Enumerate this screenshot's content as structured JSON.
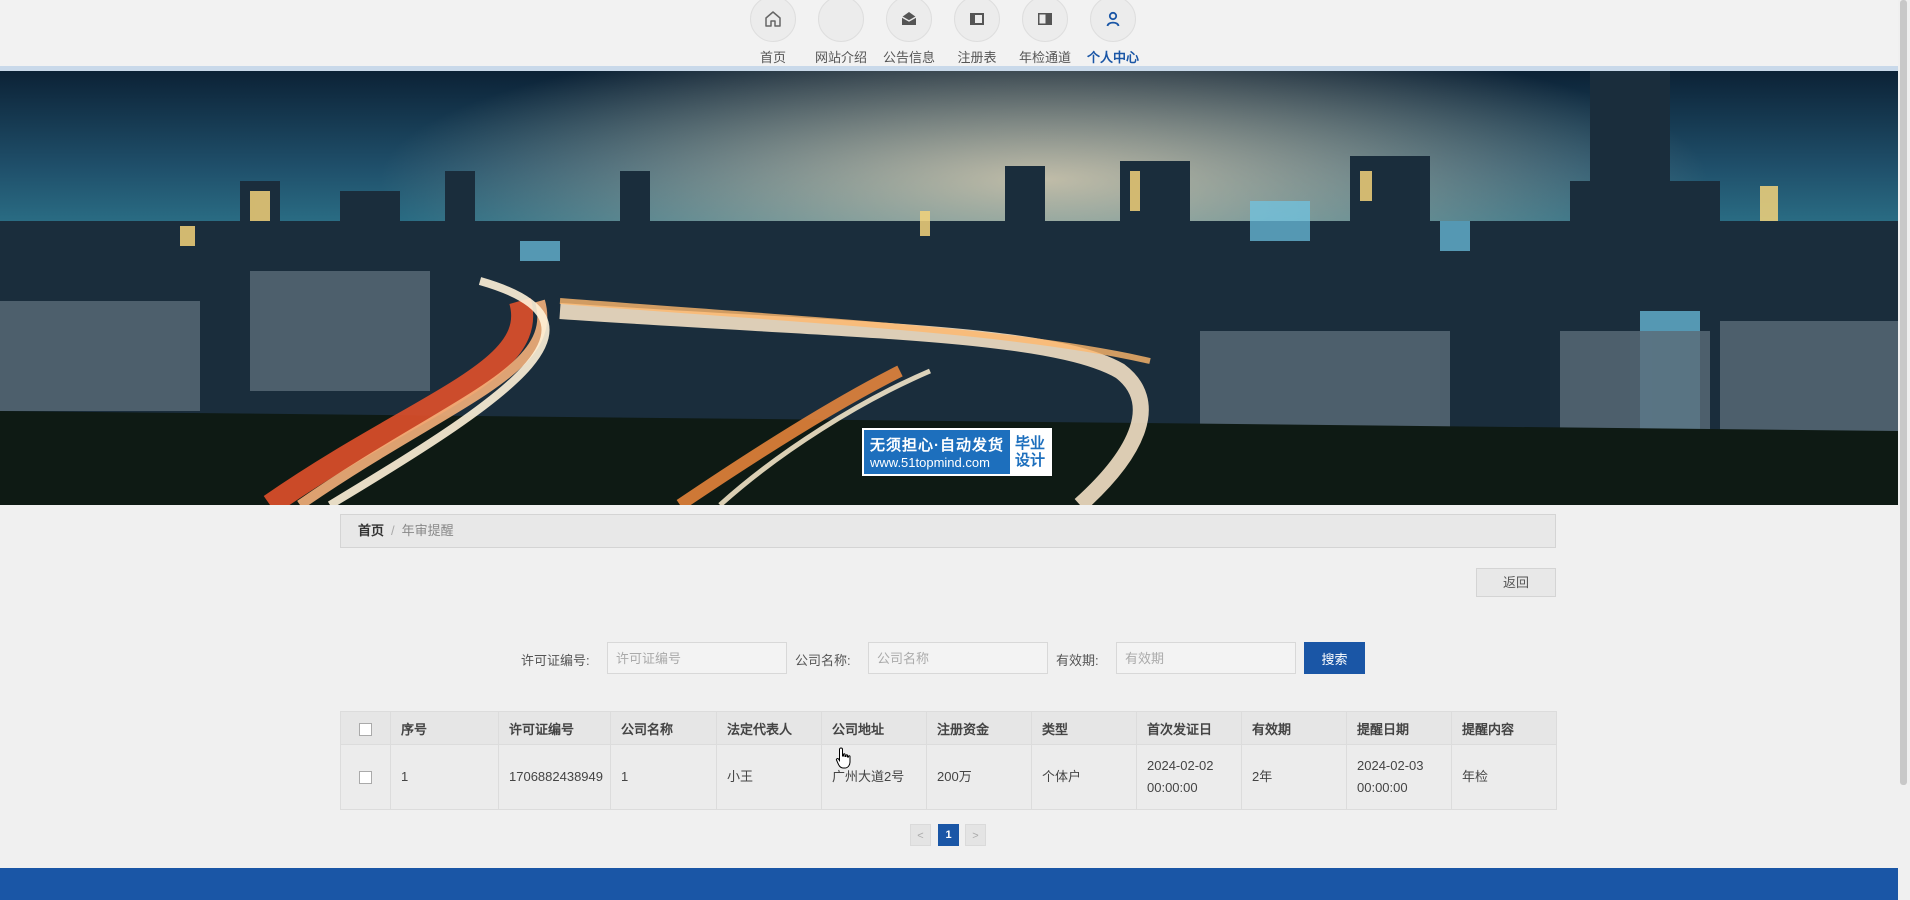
{
  "nav": {
    "items": [
      {
        "label": "首页",
        "icon": "home-icon"
      },
      {
        "label": "网站介绍",
        "icon": "blank-icon"
      },
      {
        "label": "公告信息",
        "icon": "envelope-icon"
      },
      {
        "label": "注册表",
        "icon": "sidebar-panel-icon"
      },
      {
        "label": "年检通道",
        "icon": "book-panel-icon"
      },
      {
        "label": "个人中心",
        "icon": "user-icon",
        "active": true
      }
    ]
  },
  "banner": {
    "watermark_main": "无须担心·自动发货",
    "watermark_url": "www.51topmind.com",
    "watermark_tag_line1": "毕业",
    "watermark_tag_line2": "设计"
  },
  "breadcrumb": {
    "home": "首页",
    "separator": "/",
    "current": "年审提醒"
  },
  "back_label": "返回",
  "search": {
    "license_label": "许可证编号:",
    "license_placeholder": "许可证编号",
    "company_label": "公司名称:",
    "company_placeholder": "公司名称",
    "validity_label": "有效期:",
    "validity_placeholder": "有效期",
    "button_label": "搜索"
  },
  "table": {
    "headers": [
      "序号",
      "许可证编号",
      "公司名称",
      "法定代表人",
      "公司地址",
      "注册资金",
      "类型",
      "首次发证日",
      "有效期",
      "提醒日期",
      "提醒内容"
    ],
    "rows": [
      [
        "1",
        "1706882438949",
        "1",
        "小王",
        "广州大道2号",
        "200万",
        "个体户",
        "2024-02-02 00:00:00",
        "2年",
        "2024-02-03 00:00:00",
        "年检"
      ]
    ]
  },
  "pagination": {
    "prev": "<",
    "current": "1",
    "next": ">"
  },
  "colors": {
    "primary": "#1a56a6",
    "footer": "#1a56a6"
  }
}
